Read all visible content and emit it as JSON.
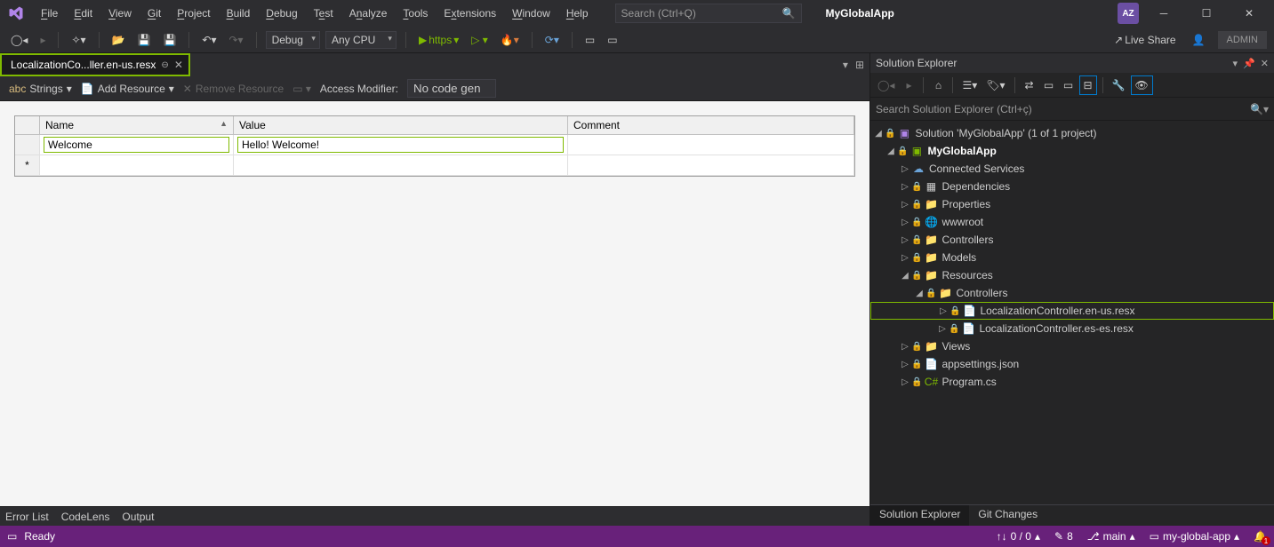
{
  "menu": [
    "File",
    "Edit",
    "View",
    "Git",
    "Project",
    "Build",
    "Debug",
    "Test",
    "Analyze",
    "Tools",
    "Extensions",
    "Window",
    "Help"
  ],
  "search_placeholder": "Search (Ctrl+Q)",
  "app_name": "MyGlobalApp",
  "user_initials": "AZ",
  "live_share": "Live Share",
  "admin": "ADMIN",
  "toolbar": {
    "config": "Debug",
    "platform": "Any CPU",
    "launch": "https"
  },
  "tab": {
    "title": "LocalizationCo...ller.en-us.resx"
  },
  "resx_toolbar": {
    "strings": "Strings",
    "add": "Add Resource",
    "remove": "Remove Resource",
    "access": "Access Modifier:",
    "codegen": "No code gen"
  },
  "grid": {
    "headers": {
      "name": "Name",
      "value": "Value",
      "comment": "Comment"
    },
    "rows": [
      {
        "name": "Welcome",
        "value": "Hello! Welcome!",
        "comment": ""
      }
    ]
  },
  "sol": {
    "title": "Solution Explorer",
    "search_placeholder": "Search Solution Explorer (Ctrl+ç)",
    "solution": "Solution 'MyGlobalApp' (1 of 1 project)",
    "project": "MyGlobalApp",
    "nodes": {
      "connected": "Connected Services",
      "dependencies": "Dependencies",
      "properties": "Properties",
      "wwwroot": "wwwroot",
      "controllers": "Controllers",
      "models": "Models",
      "resources": "Resources",
      "res_controllers": "Controllers",
      "resx_en": "LocalizationController.en-us.resx",
      "resx_es": "LocalizationController.es-es.resx",
      "views": "Views",
      "appsettings": "appsettings.json",
      "program": "Program.cs"
    },
    "footer": {
      "sol": "Solution Explorer",
      "git": "Git Changes"
    }
  },
  "bottom_tabs": [
    "Error List",
    "CodeLens",
    "Output"
  ],
  "status": {
    "ready": "Ready",
    "updown": "0 / 0",
    "pencil": "8",
    "branch": "main",
    "repo": "my-global-app"
  }
}
